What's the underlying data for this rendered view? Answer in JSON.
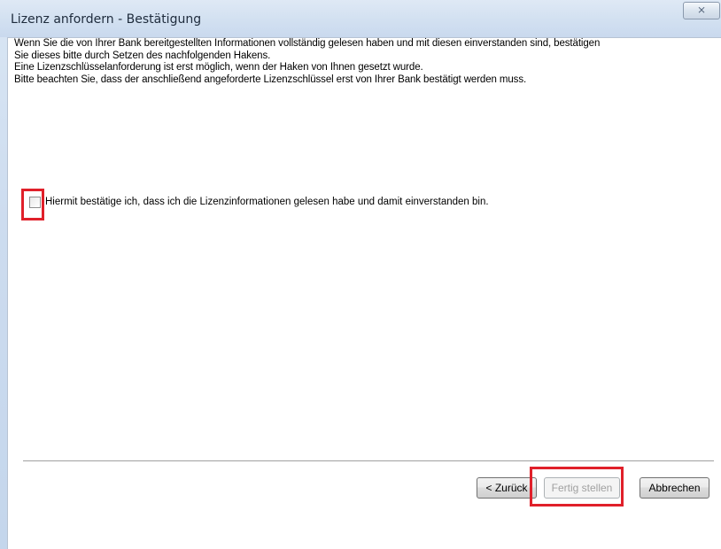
{
  "window": {
    "title": "Lizenz anfordern - Bestätigung",
    "close_symbol": "⨯",
    "close_icon": "close-icon"
  },
  "info": {
    "lines": [
      "Wenn Sie die von Ihrer Bank bereitgestellten Informationen vollständig gelesen haben und mit diesen einverstanden sind, bestätigen",
      "Sie dieses bitte durch Setzen des nachfolgenden Hakens.",
      "Eine Lizenzschlüsselanforderung ist erst möglich, wenn der Haken von Ihnen gesetzt wurde.",
      "Bitte beachten Sie, dass der anschließend angeforderte Lizenzschlüssel erst von Ihrer Bank bestätigt werden muss."
    ]
  },
  "confirm": {
    "label": "Hiermit bestätige ich, dass ich die Lizenzinformationen gelesen habe und damit einverstanden bin.",
    "checked": false
  },
  "buttons": {
    "back": "< Zurück",
    "finish": "Fertig stellen",
    "finish_enabled": false,
    "cancel": "Abbrechen"
  },
  "colors": {
    "highlight": "#e0202a",
    "disabled_text": "#a0a0a0"
  }
}
